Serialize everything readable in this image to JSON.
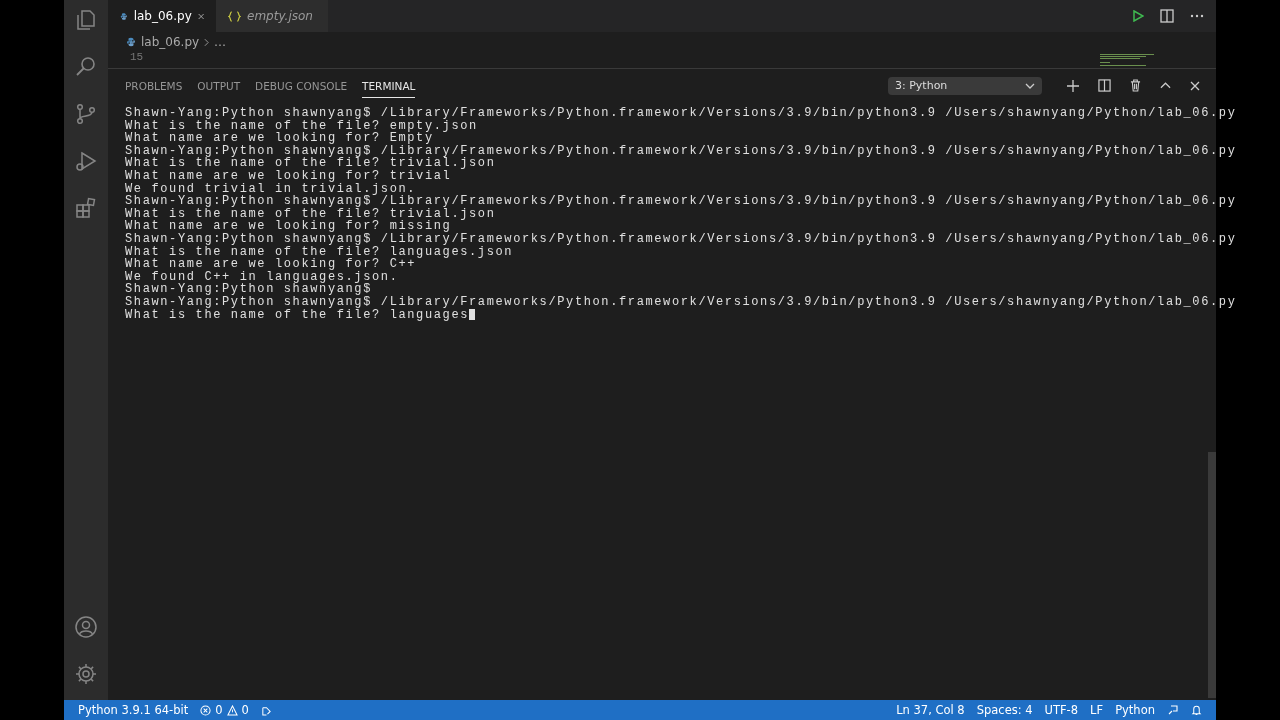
{
  "tabs": [
    {
      "label": "lab_06.py",
      "kind": "python",
      "selected": true
    },
    {
      "label": "empty.json",
      "kind": "json",
      "selected": false
    }
  ],
  "breadcrumb": {
    "file": "lab_06.py",
    "rest": "…"
  },
  "editor": {
    "line_number": "15"
  },
  "panel": {
    "tabs": [
      {
        "label": "PROBLEMS",
        "selected": false
      },
      {
        "label": "OUTPUT",
        "selected": false
      },
      {
        "label": "DEBUG CONSOLE",
        "selected": false
      },
      {
        "label": "TERMINAL",
        "selected": true
      }
    ],
    "terminal_select": "3: Python"
  },
  "terminal": {
    "lines": [
      "Shawn-Yang:Python shawnyang$ /Library/Frameworks/Python.framework/Versions/3.9/bin/python3.9 /Users/shawnyang/Python/lab_06.py",
      "What is the name of the file? empty.json",
      "What name are we looking for? Empty",
      "Shawn-Yang:Python shawnyang$ /Library/Frameworks/Python.framework/Versions/3.9/bin/python3.9 /Users/shawnyang/Python/lab_06.py",
      "What is the name of the file? trivial.json",
      "What name are we looking for? trivial",
      "We found trivial in trivial.json.",
      "Shawn-Yang:Python shawnyang$ /Library/Frameworks/Python.framework/Versions/3.9/bin/python3.9 /Users/shawnyang/Python/lab_06.py",
      "What is the name of the file? trivial.json",
      "What name are we looking for? missing",
      "Shawn-Yang:Python shawnyang$ /Library/Frameworks/Python.framework/Versions/3.9/bin/python3.9 /Users/shawnyang/Python/lab_06.py",
      "What is the name of the file? languages.json",
      "What name are we looking for? C++",
      "We found C++ in languages.json.",
      "Shawn-Yang:Python shawnyang$",
      "Shawn-Yang:Python shawnyang$ /Library/Frameworks/Python.framework/Versions/3.9/bin/python3.9 /Users/shawnyang/Python/lab_06.py",
      "What is the name of the file? languages"
    ],
    "cursor": true
  },
  "status_bar": {
    "interpreter": "Python 3.9.1 64-bit",
    "errors": "0",
    "warnings": "0",
    "position": "Ln 37, Col 8",
    "spaces": "Spaces: 4",
    "encoding": "UTF-8",
    "eol": "LF",
    "language": "Python"
  }
}
